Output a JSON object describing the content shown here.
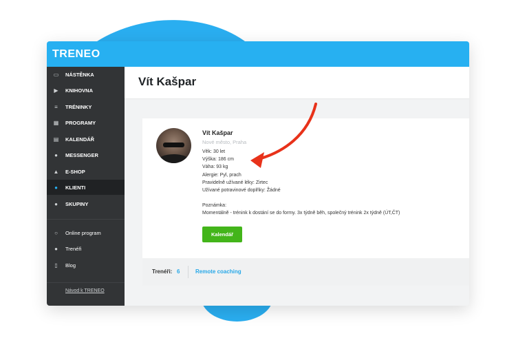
{
  "app": {
    "logo": "TRENEO"
  },
  "sidebar": {
    "items": [
      {
        "label": "NÁSTĚNKA",
        "icon": "dashboard-icon",
        "glyph": "▭"
      },
      {
        "label": "KNIHOVNA",
        "icon": "play-circle-icon",
        "glyph": "▶"
      },
      {
        "label": "TRÉNINKY",
        "icon": "list-icon",
        "glyph": "≡"
      },
      {
        "label": "PROGRAMY",
        "icon": "grid-icon",
        "glyph": "▦"
      },
      {
        "label": "KALENDÁŘ",
        "icon": "calendar-icon",
        "glyph": "▤"
      },
      {
        "label": "MESSENGER",
        "icon": "chat-icon",
        "glyph": "●"
      },
      {
        "label": "E-SHOP",
        "icon": "graduation-cap-icon",
        "glyph": "▲"
      },
      {
        "label": "KLIENTI",
        "icon": "user-icon",
        "glyph": "●",
        "active": true
      },
      {
        "label": "SKUPINY",
        "icon": "users-icon",
        "glyph": "●"
      }
    ],
    "secondary": [
      {
        "label": "Online program",
        "icon": "circle-icon",
        "glyph": "○"
      },
      {
        "label": "Trenéři",
        "icon": "users-icon",
        "glyph": "●"
      },
      {
        "label": "Blog",
        "icon": "book-icon",
        "glyph": "▯"
      }
    ],
    "footer_link": "Návod k TRENEO"
  },
  "page": {
    "title": "Vít Kašpar"
  },
  "client": {
    "name": "Vít Kašpar",
    "location": "Nové město, Praha",
    "details": [
      "Věk: 30 let",
      "Výška: 186 cm",
      "Váha: 93 kg",
      "Alergie: Pyl, prach",
      "Pravidelně užívané léky: Zirtec",
      "Užívané potravinové doplňky: Žádné"
    ],
    "note_label": "Poznámka:",
    "note": "Momentálně - trénink k dostání se do formy. 3x týdně běh, společný trénink 2x týdně (ÚT,ČT)",
    "calendar_button": "Kalendář"
  },
  "footer": {
    "trainers_label": "Trenéři:",
    "trainers_count": "6",
    "remote_link": "Remote coaching"
  },
  "colors": {
    "brand_blue": "#27b0f1",
    "sidebar_bg": "#323436",
    "button_green": "#43b51a",
    "arrow_red": "#e8321a"
  }
}
